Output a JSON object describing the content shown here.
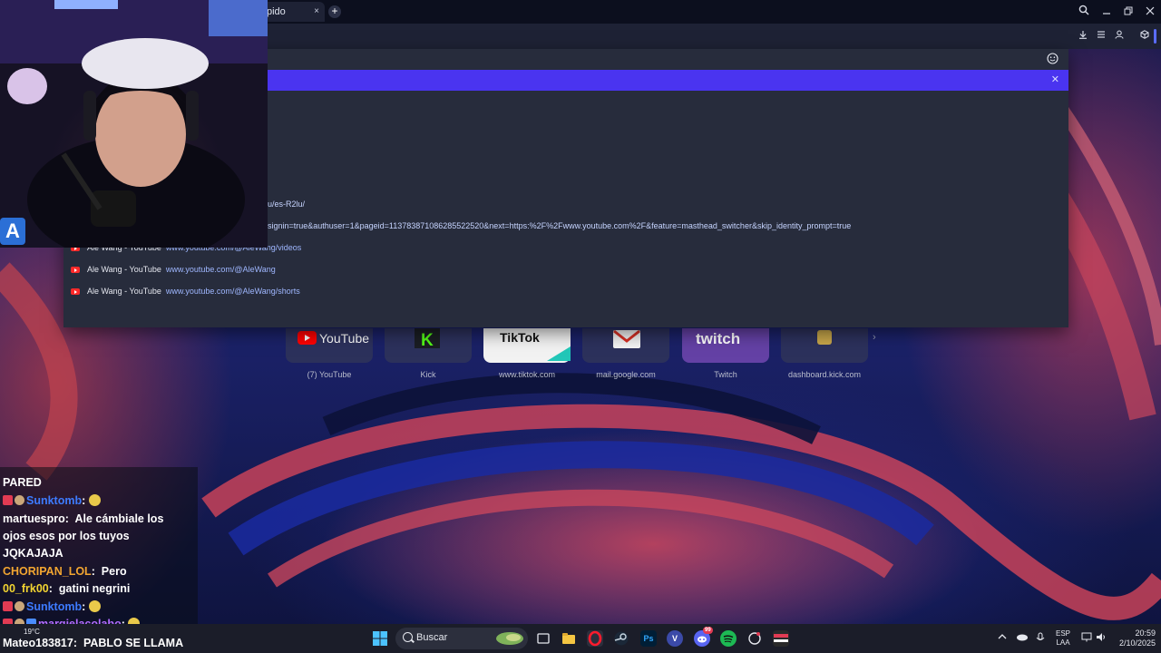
{
  "browser": {
    "tab_title": "pido",
    "tab_close": "×",
    "new_tab": "+"
  },
  "dropdown": {
    "url_fragment_1": "u/es-R2lu/",
    "url_fragment_2": "signin=true&authuser=1&pageid=113783871086285522520&next=https:%2F%2Fwww.youtube.com%2F&feature=masthead_switcher&skip_identity_prompt=true",
    "suggestions": [
      {
        "title": "Ale Wang - YouTube",
        "url": "www.youtube.com/@AleWang/videos"
      },
      {
        "title": "Ale Wang - YouTube",
        "url": "www.youtube.com/@AleWang"
      },
      {
        "title": "Ale Wang - YouTube",
        "url": "www.youtube.com/@AleWang/shorts"
      }
    ]
  },
  "speed_dial": [
    {
      "label": "(7) YouTube",
      "logo": "YouTube"
    },
    {
      "label": "Kick",
      "logo": "K"
    },
    {
      "label": "www.tiktok.com",
      "logo": "TikTok"
    },
    {
      "label": "mail.google.com",
      "logo": "M"
    },
    {
      "label": "Twitch",
      "logo": "twitch"
    },
    {
      "label": "dashboard.kick.com",
      "logo": ""
    }
  ],
  "chat": {
    "messages": [
      {
        "user": "",
        "text": "PARED",
        "user_color": "#ffffff"
      },
      {
        "user": "Sunktomb",
        "text": "",
        "user_color": "#3d7bff",
        "emote": true
      },
      {
        "user": "martuespro",
        "text": "Ale cámbiale los",
        "user_color": "#ffffff"
      },
      {
        "user": "",
        "text": "ojos esos por los tuyos",
        "user_color": "#ffffff"
      },
      {
        "user": "",
        "text": "JQKAJAJA",
        "user_color": "#ffffff"
      },
      {
        "user": "CHORIPAN_LOL",
        "text": "Pero",
        "user_color": "#f2a531"
      },
      {
        "user": "00_frk00",
        "text": "gatini negrini",
        "user_color": "#f2d431"
      },
      {
        "user": "Sunktomb",
        "text": "",
        "user_color": "#3d7bff",
        "emote": true
      },
      {
        "user": "margielacolabo",
        "text": "",
        "user_color": "#b36cff",
        "emote": true
      },
      {
        "user": "Mateo183817",
        "text": "PABLO SE LLAMA",
        "user_color": "#ffffff"
      }
    ]
  },
  "taskbar": {
    "search_placeholder": "Buscar",
    "weather": "19°C",
    "lang_1": "ESP",
    "lang_2": "LAA",
    "time": "20:59",
    "date": "2/10/2025",
    "discord_badge": "99"
  },
  "webcam": {
    "logo_letter": "A"
  },
  "colors": {
    "banner": "#4a34f0",
    "dropdown_bg": "#272c3c",
    "toolbar_bg": "#1e2235"
  }
}
